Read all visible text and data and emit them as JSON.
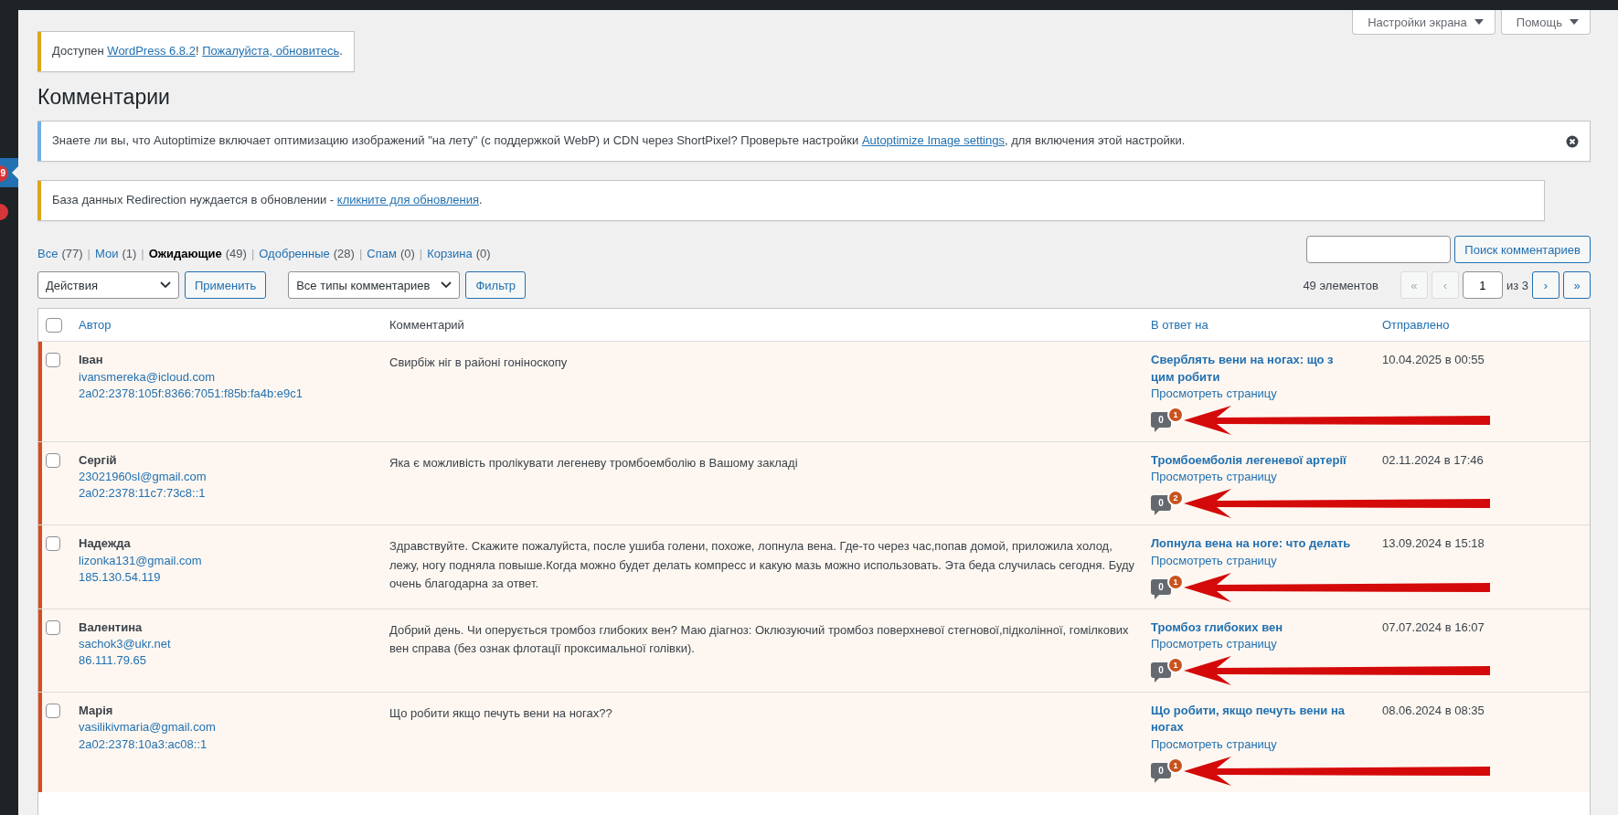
{
  "sidebar": {
    "badges": [
      {
        "text": "9",
        "current": true
      }
    ]
  },
  "screen_buttons": [
    {
      "label": "Настройки экрана"
    },
    {
      "label": "Помощь"
    }
  ],
  "update_notice": {
    "color": "#dba617",
    "parts": [
      {
        "kind": "text",
        "text": "Доступен "
      },
      {
        "kind": "link",
        "text": "WordPress 6.8.2"
      },
      {
        "kind": "text",
        "text": "! "
      },
      {
        "kind": "link",
        "text": "Пожалуйста, обновитесь"
      },
      {
        "kind": "text",
        "text": "."
      }
    ]
  },
  "page_title": "Комментарии",
  "notices": [
    {
      "color": "#72aee6",
      "dismissible": true,
      "parts": [
        {
          "kind": "text",
          "text": "Знаете ли вы, что Autoptimize включает оптимизацию изображений \"на лету\" (с поддержкой WebP) и CDN через ShortPixel? Проверьте настройки "
        },
        {
          "kind": "link",
          "text": "Autoptimize Image settings"
        },
        {
          "kind": "text",
          "text": ", для включения этой настройки."
        }
      ]
    },
    {
      "color": "#dba617",
      "dismissible": false,
      "parts": [
        {
          "kind": "text",
          "text": "База данных Redirection нуждается в обновлении - "
        },
        {
          "kind": "link",
          "text": "кликните для обновления"
        },
        {
          "kind": "text",
          "text": "."
        }
      ]
    }
  ],
  "views": {
    "separator": "|",
    "items": [
      {
        "label": "Все",
        "count": "(77)",
        "selected": false
      },
      {
        "label": "Мои",
        "count": "(1)",
        "selected": false
      },
      {
        "label": "Ожидающие",
        "count": "(49)",
        "selected": true
      },
      {
        "label": "Одобренные",
        "count": "(28)",
        "selected": false
      },
      {
        "label": "Спам",
        "count": "(0)",
        "selected": false
      },
      {
        "label": "Корзина",
        "count": "(0)",
        "selected": false
      }
    ]
  },
  "search": {
    "button": "Поиск комментариев"
  },
  "toolbar": [
    {
      "kind": "select",
      "label": "Действия"
    },
    {
      "kind": "button",
      "label": "Применить"
    },
    {
      "kind": "select",
      "label": "Все типы комментариев"
    },
    {
      "kind": "button",
      "label": "Фильтр"
    }
  ],
  "pagination": {
    "count": "49 элементов",
    "current": "1",
    "total": "из 3",
    "first_buttons": [
      {
        "label": "«",
        "disabled": true
      },
      {
        "label": "‹",
        "disabled": true
      }
    ],
    "last_buttons": [
      {
        "label": "›",
        "disabled": false
      },
      {
        "label": "»",
        "disabled": false
      }
    ]
  },
  "table": {
    "select_all_checked": false,
    "columns": [
      {
        "label": "Автор",
        "sortable": true
      },
      {
        "label": "Комментарий",
        "sortable": false
      },
      {
        "label": "В ответ на",
        "sortable": true
      },
      {
        "label": "Отправлено",
        "sortable": true
      }
    ],
    "rows": [
      {
        "pending": true,
        "checked": false,
        "author": "Іван",
        "email": "ivansmereka@icloud.com",
        "ip": "2a02:2378:105f:8366:7051:f85b:fa4b:e9c1",
        "comment": "Свирбіж ніг в районі гоніноскопу",
        "post": "Сверблять вени на ногах: що з цим робити",
        "view": "Просмотреть страницу",
        "approved": "0",
        "pending_count": "1",
        "arrow": true,
        "date": "10.04.2025 в 00:55"
      },
      {
        "pending": true,
        "checked": false,
        "author": "Сергій",
        "email": "23021960sl@gmail.com",
        "ip": "2a02:2378:11c7:73c8::1",
        "comment": "Яка є можливість пролікувати легеневу тромбоемболію в Вашому закладі",
        "post": "Тромбоемболія легеневої артерії",
        "view": "Просмотреть страницу",
        "approved": "0",
        "pending_count": "2",
        "arrow": true,
        "date": "02.11.2024 в 17:46"
      },
      {
        "pending": true,
        "checked": false,
        "author": "Надежда",
        "email": "lizonka131@gmail.com",
        "ip": "185.130.54.119",
        "comment": "Здравствуйте. Скажите пожалуйста, после ушиба голени, похоже, лопнула вена. Где-то через час,попав домой, приложила холод, лежу, ногу подняла повыше.Когда можно будет делать компресс и какую мазь можно использовать. Эта беда случилась сегодня. Буду очень благодарна за ответ.",
        "post": "Лопнула вена на ноге: что делать",
        "view": "Просмотреть страницу",
        "approved": "0",
        "pending_count": "1",
        "arrow": true,
        "date": "13.09.2024 в 15:18"
      },
      {
        "pending": true,
        "checked": false,
        "author": "Валентина",
        "email": "sachok3@ukr.net",
        "ip": "86.111.79.65",
        "comment": "Добрий день. Чи оперується тромбоз глибоких вен? Маю діагноз: Оклюзуючий тромбоз поверхневої стегнової,підколінної, гомілкових вен справа (без ознак флотації проксимальної голівки).",
        "post": "Тромбоз глибоких вен",
        "view": "Просмотреть страницу",
        "approved": "0",
        "pending_count": "1",
        "arrow": true,
        "date": "07.07.2024 в 16:07"
      },
      {
        "pending": true,
        "checked": false,
        "author": "Марія",
        "email": "vasilikivmaria@gmail.com",
        "ip": "2a02:2378:10a3:ac08::1",
        "comment": "Що робити якщо печуть вени на ногах??",
        "post": "Що робити, якщо печуть вени на ногах",
        "view": "Просмотреть страницу",
        "approved": "0",
        "pending_count": "1",
        "arrow": true,
        "date": "08.06.2024 в 08:35"
      }
    ]
  }
}
